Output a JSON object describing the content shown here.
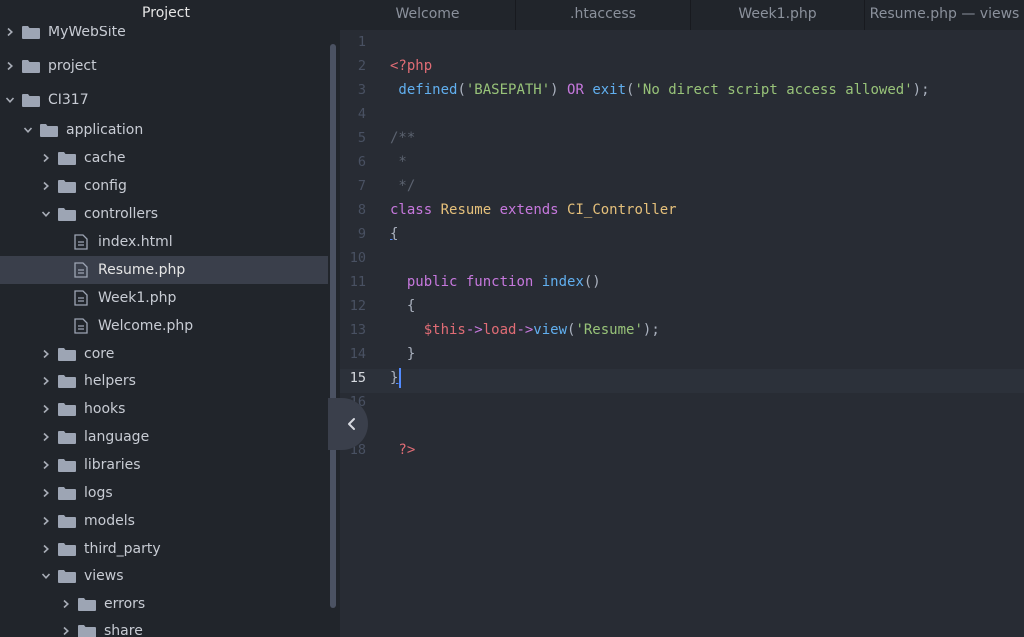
{
  "sidebar": {
    "title": "Project",
    "tree": [
      {
        "label": "MyWebSite",
        "kind": "folder",
        "depth": 0,
        "state": "collapsed"
      },
      {
        "label": "project",
        "kind": "folder",
        "depth": 0,
        "state": "collapsed"
      },
      {
        "label": "CI317",
        "kind": "folder",
        "depth": 0,
        "state": "expanded"
      },
      {
        "label": "application",
        "kind": "folder",
        "depth": 1,
        "state": "expanded"
      },
      {
        "label": "cache",
        "kind": "folder",
        "depth": 2,
        "state": "collapsed"
      },
      {
        "label": "config",
        "kind": "folder",
        "depth": 2,
        "state": "collapsed"
      },
      {
        "label": "controllers",
        "kind": "folder",
        "depth": 2,
        "state": "expanded"
      },
      {
        "label": "index.html",
        "kind": "file",
        "depth": 3
      },
      {
        "label": "Resume.php",
        "kind": "file",
        "depth": 3,
        "selected": true
      },
      {
        "label": "Week1.php",
        "kind": "file",
        "depth": 3
      },
      {
        "label": "Welcome.php",
        "kind": "file",
        "depth": 3
      },
      {
        "label": "core",
        "kind": "folder",
        "depth": 2,
        "state": "collapsed"
      },
      {
        "label": "helpers",
        "kind": "folder",
        "depth": 2,
        "state": "collapsed"
      },
      {
        "label": "hooks",
        "kind": "folder",
        "depth": 2,
        "state": "collapsed"
      },
      {
        "label": "language",
        "kind": "folder",
        "depth": 2,
        "state": "collapsed"
      },
      {
        "label": "libraries",
        "kind": "folder",
        "depth": 2,
        "state": "collapsed"
      },
      {
        "label": "logs",
        "kind": "folder",
        "depth": 2,
        "state": "collapsed"
      },
      {
        "label": "models",
        "kind": "folder",
        "depth": 2,
        "state": "collapsed"
      },
      {
        "label": "third_party",
        "kind": "folder",
        "depth": 2,
        "state": "collapsed"
      },
      {
        "label": "views",
        "kind": "folder",
        "depth": 2,
        "state": "expanded"
      },
      {
        "label": "errors",
        "kind": "folder",
        "depth": 3,
        "state": "collapsed"
      },
      {
        "label": "share",
        "kind": "folder",
        "depth": 3,
        "state": "collapsed"
      }
    ]
  },
  "tabs": [
    {
      "label": "Welcome"
    },
    {
      "label": ".htaccess"
    },
    {
      "label": "Week1.php"
    },
    {
      "label": "Resume.php — views"
    }
  ],
  "editor": {
    "active_line": "15",
    "lines": [
      {
        "n": "1",
        "tokens": []
      },
      {
        "n": "2",
        "tokens": [
          {
            "t": "<?php",
            "c": "c-red"
          }
        ]
      },
      {
        "n": "3",
        "tokens": [
          {
            "t": " defined",
            "c": "c-blue"
          },
          {
            "t": "(",
            "c": "c-plain"
          },
          {
            "t": "'BASEPATH'",
            "c": "c-green"
          },
          {
            "t": ") ",
            "c": "c-plain"
          },
          {
            "t": "OR",
            "c": "c-purple"
          },
          {
            "t": " exit",
            "c": "c-blue"
          },
          {
            "t": "(",
            "c": "c-plain"
          },
          {
            "t": "'No direct script access allowed'",
            "c": "c-green"
          },
          {
            "t": ");",
            "c": "c-plain"
          }
        ]
      },
      {
        "n": "4",
        "tokens": []
      },
      {
        "n": "5",
        "tokens": [
          {
            "t": "/**",
            "c": "c-gray"
          }
        ]
      },
      {
        "n": "6",
        "tokens": [
          {
            "t": " *",
            "c": "c-gray"
          }
        ]
      },
      {
        "n": "7",
        "tokens": [
          {
            "t": " */",
            "c": "c-gray"
          }
        ]
      },
      {
        "n": "8",
        "tokens": [
          {
            "t": "class",
            "c": "c-purple"
          },
          {
            "t": " Resume",
            "c": "c-yellow"
          },
          {
            "t": " extends",
            "c": "c-purple"
          },
          {
            "t": " CI_Controller",
            "c": "c-yellow"
          }
        ]
      },
      {
        "n": "9",
        "tokens": [
          {
            "t": "{",
            "c": "c-plain underline"
          }
        ]
      },
      {
        "n": "10",
        "tokens": []
      },
      {
        "n": "11",
        "tokens": [
          {
            "t": "  public",
            "c": "c-purple"
          },
          {
            "t": " function",
            "c": "c-purple"
          },
          {
            "t": " index",
            "c": "c-blue"
          },
          {
            "t": "()",
            "c": "c-plain"
          }
        ]
      },
      {
        "n": "12",
        "tokens": [
          {
            "t": "  {",
            "c": "c-plain"
          }
        ]
      },
      {
        "n": "13",
        "tokens": [
          {
            "t": "    $this",
            "c": "c-red"
          },
          {
            "t": "->",
            "c": "c-purple"
          },
          {
            "t": "load",
            "c": "c-red"
          },
          {
            "t": "->",
            "c": "c-purple"
          },
          {
            "t": "view",
            "c": "c-blue"
          },
          {
            "t": "(",
            "c": "c-plain"
          },
          {
            "t": "'Resume'",
            "c": "c-green"
          },
          {
            "t": ");",
            "c": "c-plain"
          }
        ]
      },
      {
        "n": "14",
        "tokens": [
          {
            "t": "  }",
            "c": "c-plain"
          }
        ]
      },
      {
        "n": "15",
        "tokens": [
          {
            "t": "}",
            "c": "c-plain underline"
          }
        ],
        "cursor": true
      },
      {
        "n": "16",
        "tokens": []
      },
      {
        "n": "17",
        "tokens": []
      },
      {
        "n": "18",
        "tokens": [
          {
            "t": " ?>",
            "c": "c-red"
          }
        ]
      }
    ]
  },
  "colors": {
    "background": "#282c34",
    "sidebar": "#21252b",
    "selection": "#3a3f4b",
    "cursor": "#528bff"
  },
  "icons": {
    "folder": "folder-icon",
    "file": "file-icon",
    "collapsed": "chevron-right-icon",
    "expanded": "chevron-down-icon",
    "panel_toggle": "chevron-left-icon"
  }
}
